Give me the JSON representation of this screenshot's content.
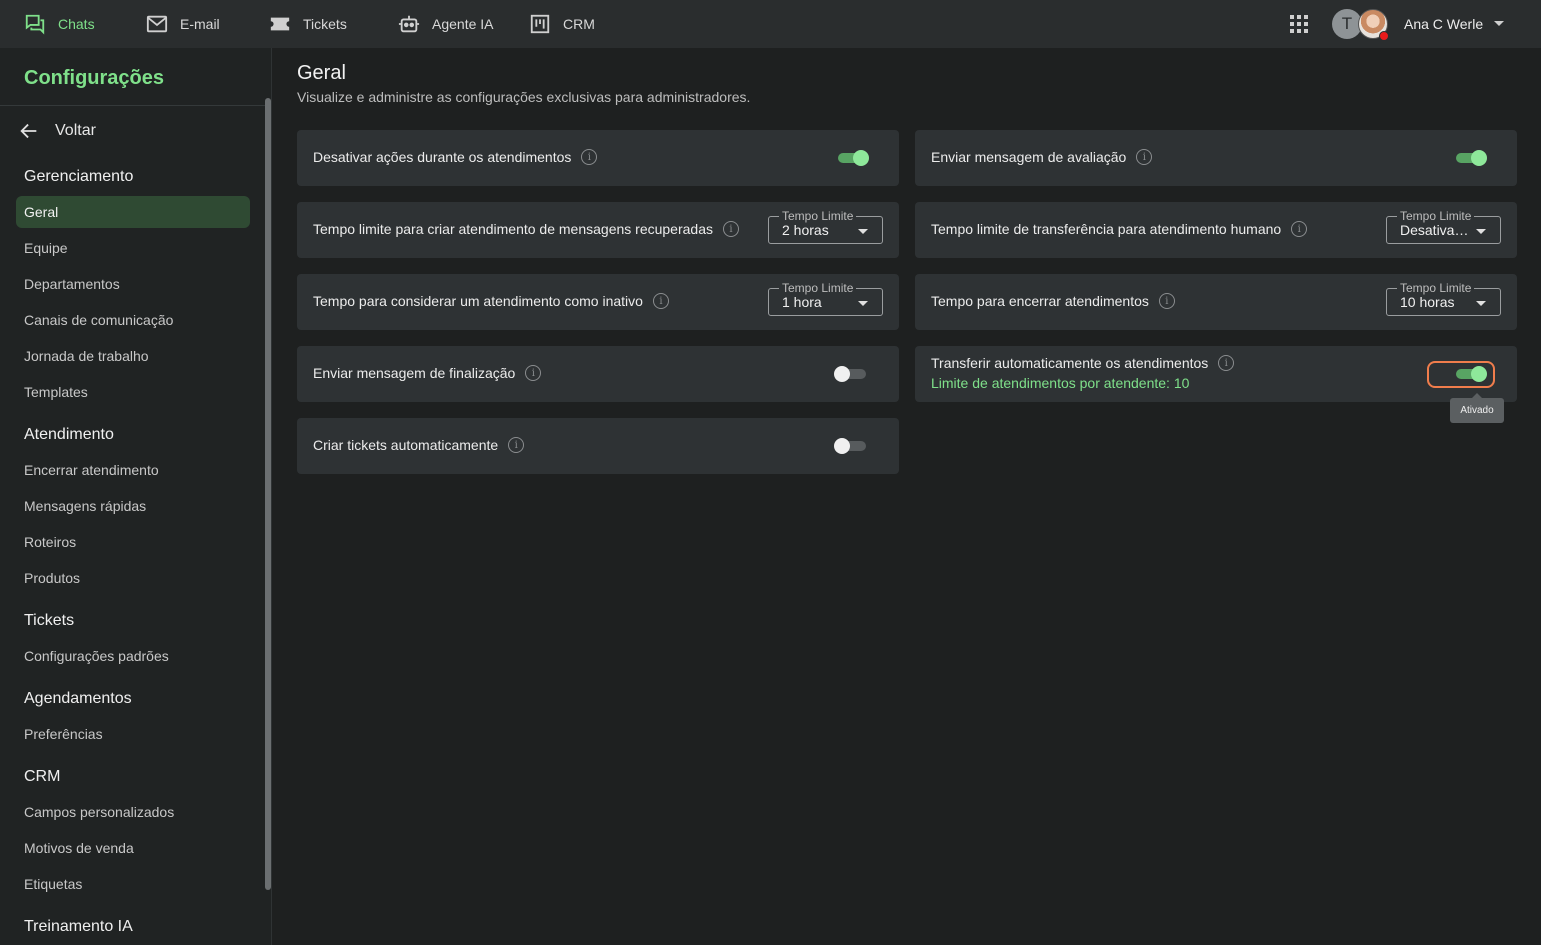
{
  "topnav": {
    "items": [
      {
        "label": "Chats",
        "icon": "chat-icon"
      },
      {
        "label": "E-mail",
        "icon": "mail-icon"
      },
      {
        "label": "Tickets",
        "icon": "ticket-icon"
      },
      {
        "label": "Agente IA",
        "icon": "robot-icon"
      },
      {
        "label": "CRM",
        "icon": "kanban-icon"
      }
    ],
    "avatar_initial": "T",
    "user_name": "Ana C Werle",
    "accent": "#7fe08a"
  },
  "sidebar": {
    "title": "Configurações",
    "back_label": "Voltar",
    "sections": [
      {
        "title": "Gerenciamento",
        "items": [
          "Geral",
          "Equipe",
          "Departamentos",
          "Canais de comunicação",
          "Jornada de trabalho",
          "Templates"
        ]
      },
      {
        "title": "Atendimento",
        "items": [
          "Encerrar atendimento",
          "Mensagens rápidas",
          "Roteiros",
          "Produtos"
        ]
      },
      {
        "title": "Tickets",
        "items": [
          "Configurações padrões"
        ]
      },
      {
        "title": "Agendamentos",
        "items": [
          "Preferências"
        ]
      },
      {
        "title": "CRM",
        "items": [
          "Campos personalizados",
          "Motivos de venda",
          "Etiquetas"
        ]
      },
      {
        "title": "Treinamento IA",
        "items": []
      }
    ],
    "active_item": "Geral"
  },
  "main": {
    "title": "Geral",
    "subtitle": "Visualize e administre as configurações exclusivas para administradores.",
    "settings": {
      "disable_actions": {
        "label": "Desativar ações durante os atendimentos",
        "enabled": true
      },
      "send_rating": {
        "label": "Enviar mensagem de avaliação",
        "enabled": true
      },
      "recovered_timeout": {
        "label": "Tempo limite para criar atendimento de mensagens recuperadas",
        "legend": "Tempo Limite",
        "value": "2 horas"
      },
      "human_transfer_timeout": {
        "label": "Tempo limite de transferência para atendimento humano",
        "legend": "Tempo Limite",
        "value": "Desativa…"
      },
      "inactive_time": {
        "label": "Tempo para considerar um atendimento como inativo",
        "legend": "Tempo Limite",
        "value": "1 hora"
      },
      "close_time": {
        "label": "Tempo para encerrar atendimentos",
        "legend": "Tempo Limite",
        "value": "10 horas"
      },
      "send_finish": {
        "label": "Enviar mensagem de finalização",
        "enabled": false
      },
      "auto_transfer": {
        "label": "Transferir automaticamente os atendimentos",
        "sublabel": "Limite de atendimentos por atendente: 10",
        "enabled": true,
        "tooltip": "Ativado"
      },
      "auto_tickets": {
        "label": "Criar tickets automaticamente",
        "enabled": false
      }
    }
  }
}
